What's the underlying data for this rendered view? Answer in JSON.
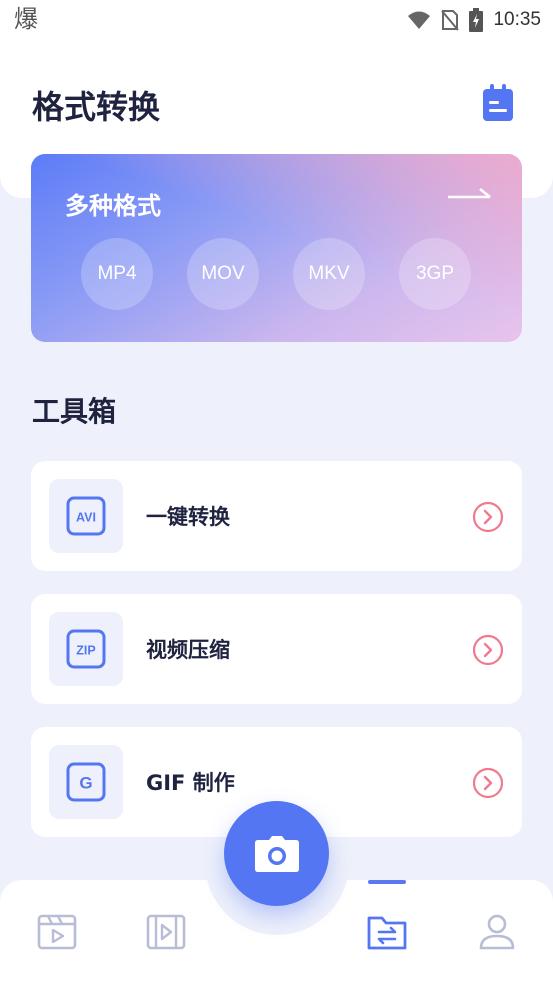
{
  "status_bar": {
    "app_glyph": "爆",
    "time": "10:35",
    "icons": [
      "wifi-icon",
      "no-sim-icon",
      "battery-charging-icon"
    ]
  },
  "header": {
    "title": "格式转换",
    "action_icon": "calendar-icon"
  },
  "banner": {
    "title": "多种格式",
    "arrow_icon": "arrow-right-icon",
    "formats": [
      "MP4",
      "MOV",
      "MKV",
      "3GP"
    ]
  },
  "toolbox": {
    "title": "工具箱",
    "items": [
      {
        "label": "一键转换",
        "icon_text": "AVI",
        "icon": "avi-file-icon"
      },
      {
        "label": "视频压缩",
        "icon_text": "ZIP",
        "icon": "zip-file-icon"
      },
      {
        "label": "GIF 制作",
        "icon_text": "G",
        "icon": "gif-icon"
      }
    ]
  },
  "bottom_nav": {
    "items": [
      "video-player-icon",
      "film-strip-icon",
      "folder-convert-icon",
      "profile-icon"
    ],
    "active_index": 2,
    "fab_icon": "camera-icon"
  },
  "colors": {
    "accent": "#5576f2",
    "chevron": "#f07a8e",
    "title_text": "#1f2340",
    "background": "#eef1fb"
  }
}
